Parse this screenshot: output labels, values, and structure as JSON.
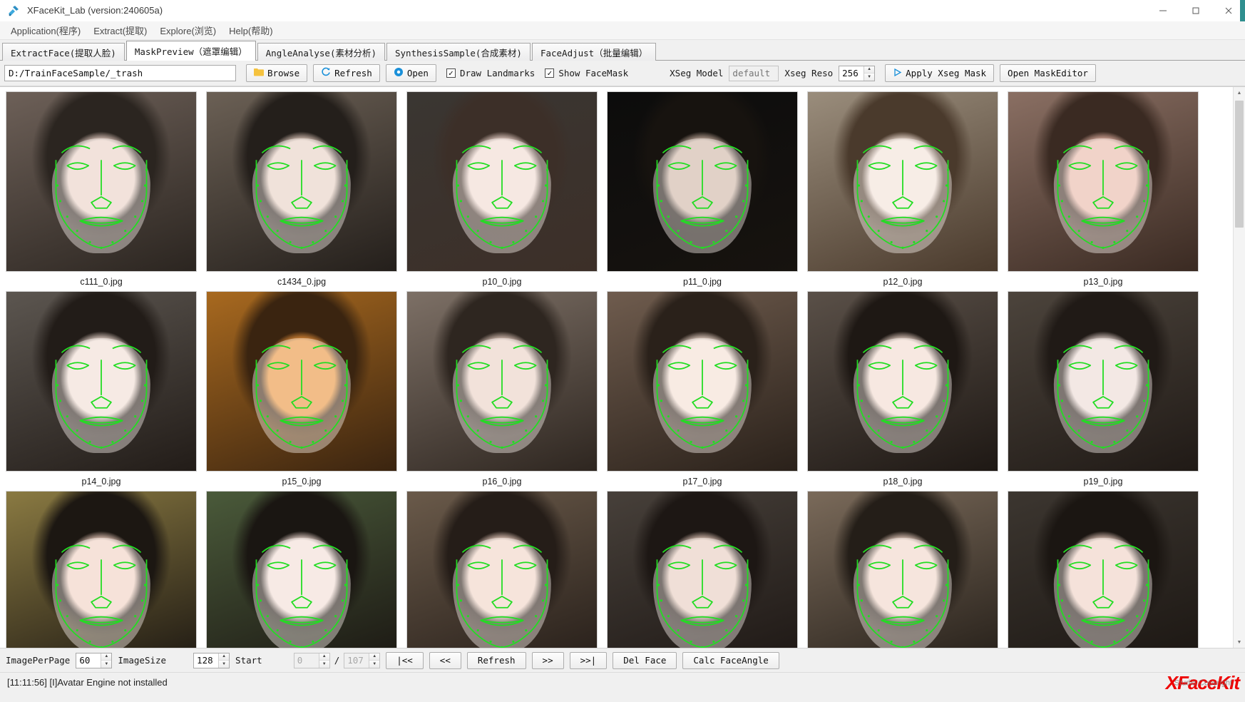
{
  "window": {
    "title": "XFaceKit_Lab (version:240605a)",
    "icon": "tools-icon",
    "minimize": "–",
    "maximize": "□",
    "close": "✕"
  },
  "menu": {
    "items": [
      {
        "label": "Application(程序)",
        "name": "menu-application"
      },
      {
        "label": "Extract(提取)",
        "name": "menu-extract"
      },
      {
        "label": "Explore(浏览)",
        "name": "menu-explore"
      },
      {
        "label": "Help(帮助)",
        "name": "menu-help"
      }
    ]
  },
  "tabs": [
    {
      "label": "ExtractFace(提取人脸)",
      "active": false
    },
    {
      "label": "MaskPreview（遮罩编辑）",
      "active": true
    },
    {
      "label": "AngleAnalyse(素材分析)",
      "active": false
    },
    {
      "label": "SynthesisSample(合成素材)",
      "active": false
    },
    {
      "label": "FaceAdjust（批量编辑）",
      "active": false
    }
  ],
  "toolbar": {
    "path_value": "D:/TrainFaceSample/_trash",
    "path_placeholder": "",
    "browse_label": "Browse",
    "refresh_label": "Refresh",
    "open_label": "Open",
    "draw_landmarks_label": "Draw Landmarks",
    "draw_landmarks_checked": "✓",
    "show_facemask_label": "Show FaceMask",
    "show_facemask_checked": "✓",
    "xseg_model_label": "XSeg Model",
    "xseg_model_placeholder": "default",
    "xseg_model_value": "",
    "xseg_reso_label": "Xseg Reso",
    "xseg_reso_value": "256",
    "apply_xseg_label": "Apply Xseg Mask",
    "open_maskeditor_label": "Open  MaskEditor"
  },
  "bottombar": {
    "image_per_page_label": "ImagePerPage",
    "image_per_page_value": "60",
    "image_size_label": "ImageSize",
    "image_size_value": "128",
    "start_label": "Start",
    "start_value": "0",
    "separator": "/",
    "total_value": "107",
    "first_label": "|<<",
    "prev_label": "<<",
    "refresh_label": "Refresh",
    "next_label": ">>",
    "last_label": ">>|",
    "del_face_label": "Del Face",
    "calc_face_angle_label": "Calc FaceAngle"
  },
  "status": {
    "message": "[11:11:56] [I]Avatar Engine not installed",
    "brand": "XFaceKit",
    "brand_sub": "Studio Copyright"
  },
  "colors": {
    "landmark_green": "#22dd22",
    "brand_red": "#ee0000",
    "accent_blue": "#1a90d9",
    "folder_yellow": "#f5c23e"
  },
  "gallery": {
    "items": [
      {
        "filename": "c111_0.jpg",
        "bg": "#6d6058",
        "hair": "#2b2520",
        "skin": "#e8cfc4"
      },
      {
        "filename": "c1434_0.jpg",
        "bg": "#6b6055",
        "hair": "#241f1b",
        "skin": "#e6cec1"
      },
      {
        "filename": "p10_0.jpg",
        "bg": "#3a3632",
        "hair": "#3c2f28",
        "skin": "#f0d8cf"
      },
      {
        "filename": "p11_0.jpg",
        "bg": "#0c0c0c",
        "hair": "#17130f",
        "skin": "#cbb2a3"
      },
      {
        "filename": "p12_0.jpg",
        "bg": "#9a8d7c",
        "hair": "#4a3a2c",
        "skin": "#f2e0d6"
      },
      {
        "filename": "p13_0.jpg",
        "bg": "#8a6f63",
        "hair": "#3a2a22",
        "skin": "#e7b5a6"
      },
      {
        "filename": "p14_0.jpg",
        "bg": "#5c5650",
        "hair": "#221c18",
        "skin": "#f0dcd2"
      },
      {
        "filename": "p15_0.jpg",
        "bg": "#a8691f",
        "hair": "#3a2410",
        "skin": "#e8913a"
      },
      {
        "filename": "p16_0.jpg",
        "bg": "#7d7066",
        "hair": "#2e2620",
        "skin": "#e8cec2"
      },
      {
        "filename": "p17_0.jpg",
        "bg": "#6f5c4e",
        "hair": "#2a211a",
        "skin": "#f3ddd1"
      },
      {
        "filename": "p18_0.jpg",
        "bg": "#5a5048",
        "hair": "#1e1814",
        "skin": "#f1d9cd"
      },
      {
        "filename": "p19_0.jpg",
        "bg": "#4c443c",
        "hair": "#201a16",
        "skin": "#ead8d2"
      },
      {
        "filename": "",
        "bg": "#8a7a42",
        "hair": "#1c1712",
        "skin": "#f0cfc0"
      },
      {
        "filename": "",
        "bg": "#4a5a3a",
        "hair": "#1a1612",
        "skin": "#f2dcd4"
      },
      {
        "filename": "",
        "bg": "#6a5a4a",
        "hair": "#251d18",
        "skin": "#efd2c4"
      },
      {
        "filename": "",
        "bg": "#47403a",
        "hair": "#1d1714",
        "skin": "#e6cabc"
      },
      {
        "filename": "",
        "bg": "#7a6a5a",
        "hair": "#241e18",
        "skin": "#f0d4c6"
      },
      {
        "filename": "",
        "bg": "#3c3630",
        "hair": "#1b1612",
        "skin": "#edcfc2"
      }
    ]
  }
}
